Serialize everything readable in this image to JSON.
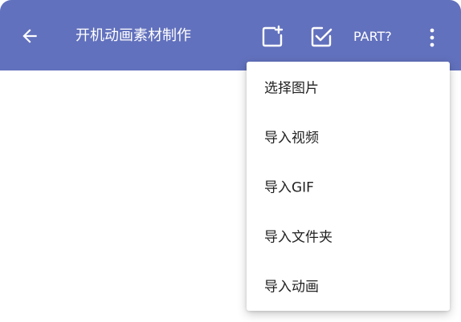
{
  "app_bar": {
    "title": "开机动画素材制作",
    "part_label": "PART?",
    "background_color": "#6271bd",
    "icons": {
      "back": "arrow-left-icon",
      "add_frame": "add-frame-icon",
      "select": "checkbox-checked-icon",
      "more": "more-vertical-icon"
    }
  },
  "overflow_menu": {
    "items": [
      {
        "label": "选择图片"
      },
      {
        "label": "导入视频"
      },
      {
        "label": "导入GIF"
      },
      {
        "label": "导入文件夹"
      },
      {
        "label": "导入动画"
      }
    ]
  }
}
